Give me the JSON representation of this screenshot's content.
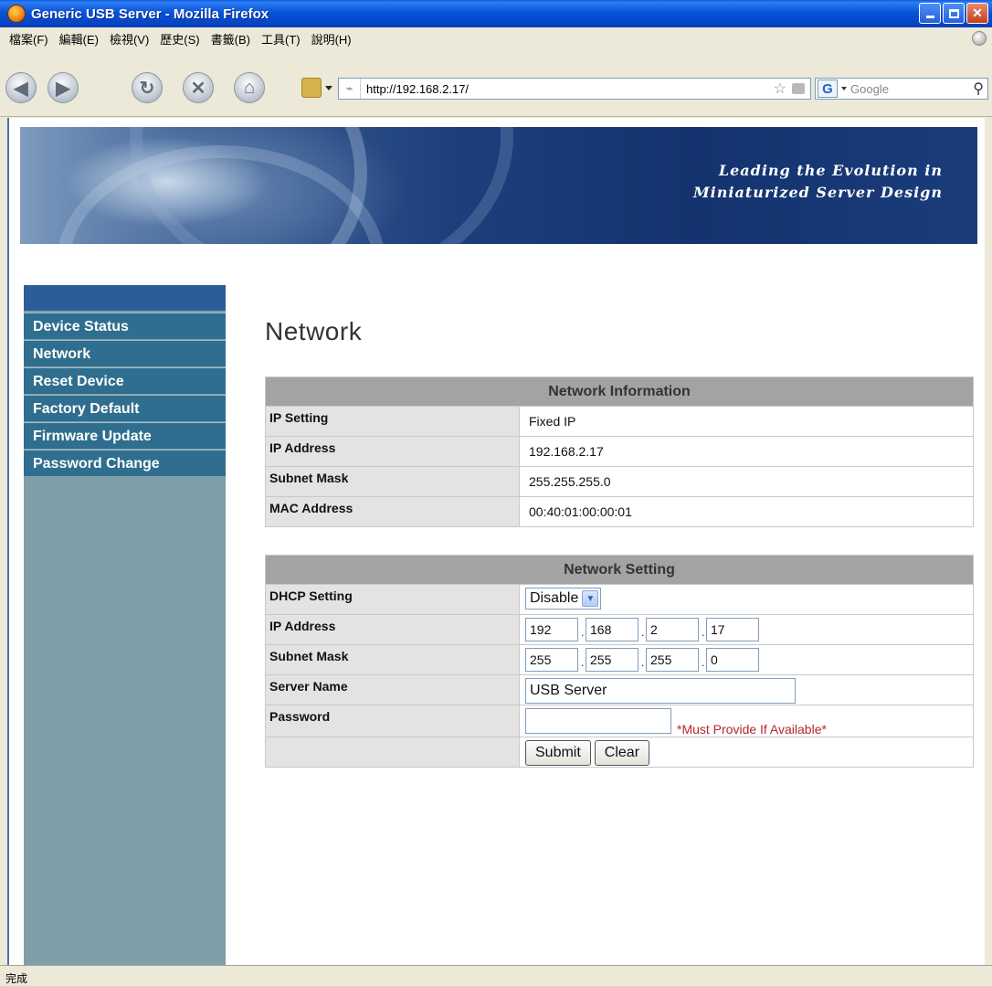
{
  "window": {
    "title": "Generic USB Server - Mozilla Firefox",
    "icon": "firefox-icon"
  },
  "menu": {
    "items": [
      {
        "label": "檔案(F)"
      },
      {
        "label": "編輯(E)"
      },
      {
        "label": "檢視(V)"
      },
      {
        "label": "歷史(S)"
      },
      {
        "label": "書籤(B)"
      },
      {
        "label": "工具(T)"
      },
      {
        "label": "說明(H)"
      }
    ]
  },
  "toolbar": {
    "url": "http://192.168.2.17/",
    "search_placeholder": "Google",
    "icons": [
      "back-icon",
      "forward-icon",
      "reload-icon",
      "stop-icon",
      "home-icon",
      "bookmark-icon",
      "star-icon",
      "rss-icon",
      "google-icon",
      "magnifier-icon"
    ]
  },
  "banner": {
    "line1": "Leading the Evolution in",
    "line2": "Miniaturized Server Design"
  },
  "sidebar": {
    "items": [
      {
        "label": "Device Status"
      },
      {
        "label": "Network"
      },
      {
        "label": "Reset Device"
      },
      {
        "label": "Factory Default"
      },
      {
        "label": "Firmware Update"
      },
      {
        "label": "Password Change"
      }
    ]
  },
  "page": {
    "title": "Network"
  },
  "network_information": {
    "header": "Network Information",
    "rows": [
      {
        "label": "IP Setting",
        "value": "Fixed IP"
      },
      {
        "label": "IP Address",
        "value": "192.168.2.17"
      },
      {
        "label": "Subnet Mask",
        "value": "255.255.255.0"
      },
      {
        "label": "MAC Address",
        "value": "00:40:01:00:00:01"
      }
    ]
  },
  "network_setting": {
    "header": "Network Setting",
    "dhcp": {
      "label": "DHCP Setting",
      "selected": "Disable"
    },
    "ip": {
      "label": "IP Address",
      "octets": [
        "192",
        "168",
        "2",
        "17"
      ]
    },
    "subnet": {
      "label": "Subnet Mask",
      "octets": [
        "255",
        "255",
        "255",
        "0"
      ]
    },
    "server_name": {
      "label": "Server Name",
      "value": "USB Server"
    },
    "password": {
      "label": "Password",
      "value": "",
      "note": "*Must Provide If Available*"
    },
    "submit_label": "Submit",
    "clear_label": "Clear"
  },
  "status": {
    "text": "完成"
  },
  "colors": {
    "titlebar": "#0953d9",
    "sidebar_item": "#2f6e8e",
    "sidebar_bg": "#7f9fa8",
    "table_header": "#a3a3a3",
    "required_note": "#b3262d"
  }
}
